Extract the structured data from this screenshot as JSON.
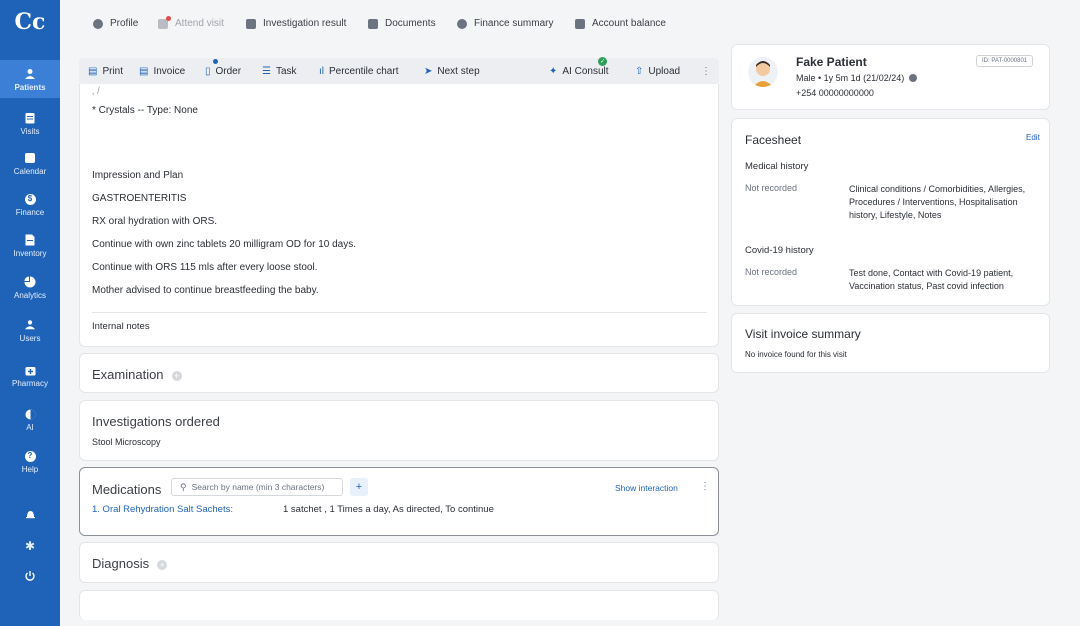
{
  "app": {
    "logo_glyph": "Cc"
  },
  "sidebar": {
    "items": [
      {
        "label": "Patients",
        "icon": "patients-icon",
        "active": true
      },
      {
        "label": "Visits",
        "icon": "visits-icon"
      },
      {
        "label": "Calendar",
        "icon": "calendar-icon"
      },
      {
        "label": "Finance",
        "icon": "finance-icon"
      },
      {
        "label": "Inventory",
        "icon": "inventory-icon"
      },
      {
        "label": "Analytics",
        "icon": "analytics-icon"
      },
      {
        "label": "Users",
        "icon": "users-icon"
      },
      {
        "label": "Pharmacy",
        "icon": "pharmacy-icon"
      },
      {
        "label": "AI",
        "icon": "ai-icon"
      },
      {
        "label": "Help",
        "icon": "help-icon"
      }
    ]
  },
  "top_tabs": [
    {
      "label": "Profile",
      "icon": "person-icon"
    },
    {
      "label": "Attend visit",
      "icon": "attend-icon",
      "disabled": true
    },
    {
      "label": "Investigation result",
      "icon": "flask-icon"
    },
    {
      "label": "Documents",
      "icon": "document-icon"
    },
    {
      "label": "Finance summary",
      "icon": "finance-icon"
    },
    {
      "label": "Account balance",
      "icon": "account-icon"
    }
  ],
  "toolbar": {
    "print": "Print",
    "invoice": "Invoice",
    "order": "Order",
    "task": "Task",
    "percentile_chart": "Percentile chart",
    "next_step": "Next step",
    "ai_consult": "AI Consult",
    "upload": "Upload"
  },
  "notes": {
    "crystals": "* Crystals -- Type: None",
    "impression_heading": "Impression and Plan",
    "diagnosis_line": "GASTROENTERITIS",
    "rx": "RX oral hydration with ORS.",
    "zinc": "Continue with own zinc tablets 20 milligram OD for 10 days.",
    "ors": "Continue with ORS 115 mls after every loose stool.",
    "breastfeed": "Mother advised to continue breastfeeding the baby.",
    "internal_notes": "Internal notes"
  },
  "examination": {
    "title": "Examination"
  },
  "investigations": {
    "title": "Investigations ordered",
    "item": "Stool Microscopy"
  },
  "medications": {
    "title": "Medications",
    "search_placeholder": "Search by name (min 3 characters)",
    "add": "+",
    "show_interaction": "Show interaction",
    "item_name": "1. Oral Rehydration Salt Sachets:",
    "item_detail": "1 satchet , 1 Times a day, As directed, To continue"
  },
  "diagnosis": {
    "title": "Diagnosis"
  },
  "patient": {
    "name": "Fake Patient",
    "id": "ID: PAT-0000801",
    "details": "Male • 1y 5m 1d (21/02/24)",
    "phone": "+254 00000000000"
  },
  "facesheet": {
    "title": "Facesheet",
    "edit": "Edit",
    "medical_history": "Medical history",
    "mh_status": "Not recorded",
    "mh_items": "Clinical conditions / Comorbidities, Allergies, Procedures / Interventions, Hospitalisation history, Lifestyle, Notes",
    "covid_history": "Covid-19 history",
    "covid_status": "Not recorded",
    "covid_items": "Test done, Contact with Covid-19 patient, Vaccination status, Past covid infection"
  },
  "invoice_summary": {
    "title": "Visit invoice summary",
    "empty": "No invoice found for this visit"
  }
}
